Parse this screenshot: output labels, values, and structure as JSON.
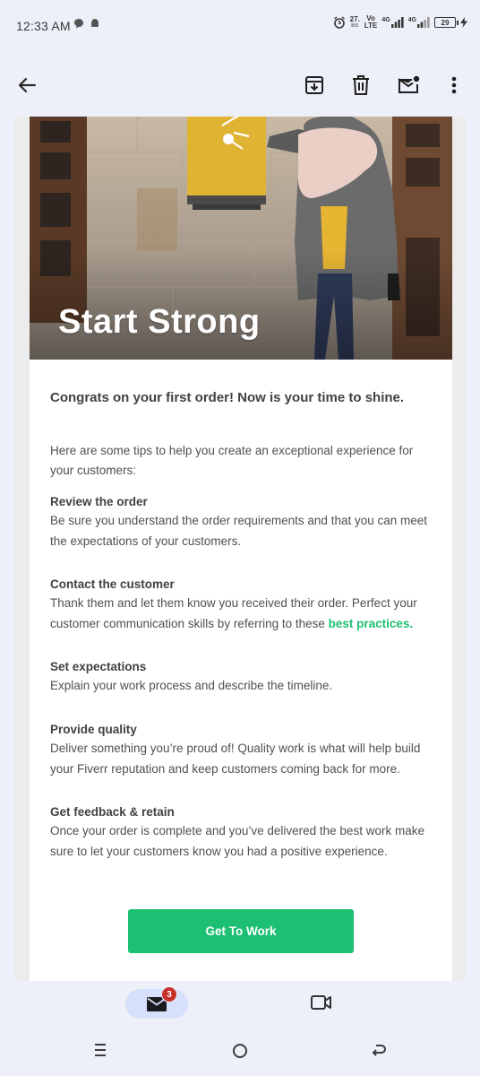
{
  "status_bar": {
    "time": "12:33 AM",
    "speed": "27.",
    "speed_unit": "B/S",
    "volte_top": "Vo",
    "volte_bottom": "LTE",
    "net1": "4G",
    "net2": "4G",
    "battery": "29"
  },
  "app_bar": {
    "back_icon": "arrow-back-icon",
    "archive_icon": "archive-icon",
    "delete_icon": "trash-icon",
    "mark_unread_icon": "mark-unread-icon",
    "more_icon": "more-vert-icon"
  },
  "email": {
    "hero_title": "Start Strong",
    "intro_heading": "Congrats on your first order! Now is your time to shine.",
    "intro_text": "Here are some tips to help you create an exceptional experience for your customers:",
    "tips": [
      {
        "title": "Review the order",
        "body": "Be sure you understand the order requirements and that you can meet the expectations of your customers."
      },
      {
        "title": "Contact the customer",
        "body": "Thank them and let them know you received their order. Perfect your customer communication skills by referring to these ",
        "link": "best practices."
      },
      {
        "title": "Set expectations",
        "body": "Explain your work process and describe the timeline."
      },
      {
        "title": "Provide quality",
        "body": "Deliver something you’re proud of! Quality work is what will help build your Fiverr reputation and keep customers coming back for more."
      },
      {
        "title": "Get feedback & retain",
        "body": "Once your order is complete and you’ve delivered the best work make sure to let your customers know you had a positive experience."
      }
    ],
    "cta_label": "Get To Work",
    "accent_color": "#1dbf73"
  },
  "bottom_nav": {
    "mail_badge": "3",
    "mail_icon": "mail-icon",
    "meet_icon": "video-camera-icon"
  },
  "system_nav": {
    "recents_icon": "recents-icon",
    "home_icon": "home-icon",
    "back_icon": "back-icon"
  }
}
